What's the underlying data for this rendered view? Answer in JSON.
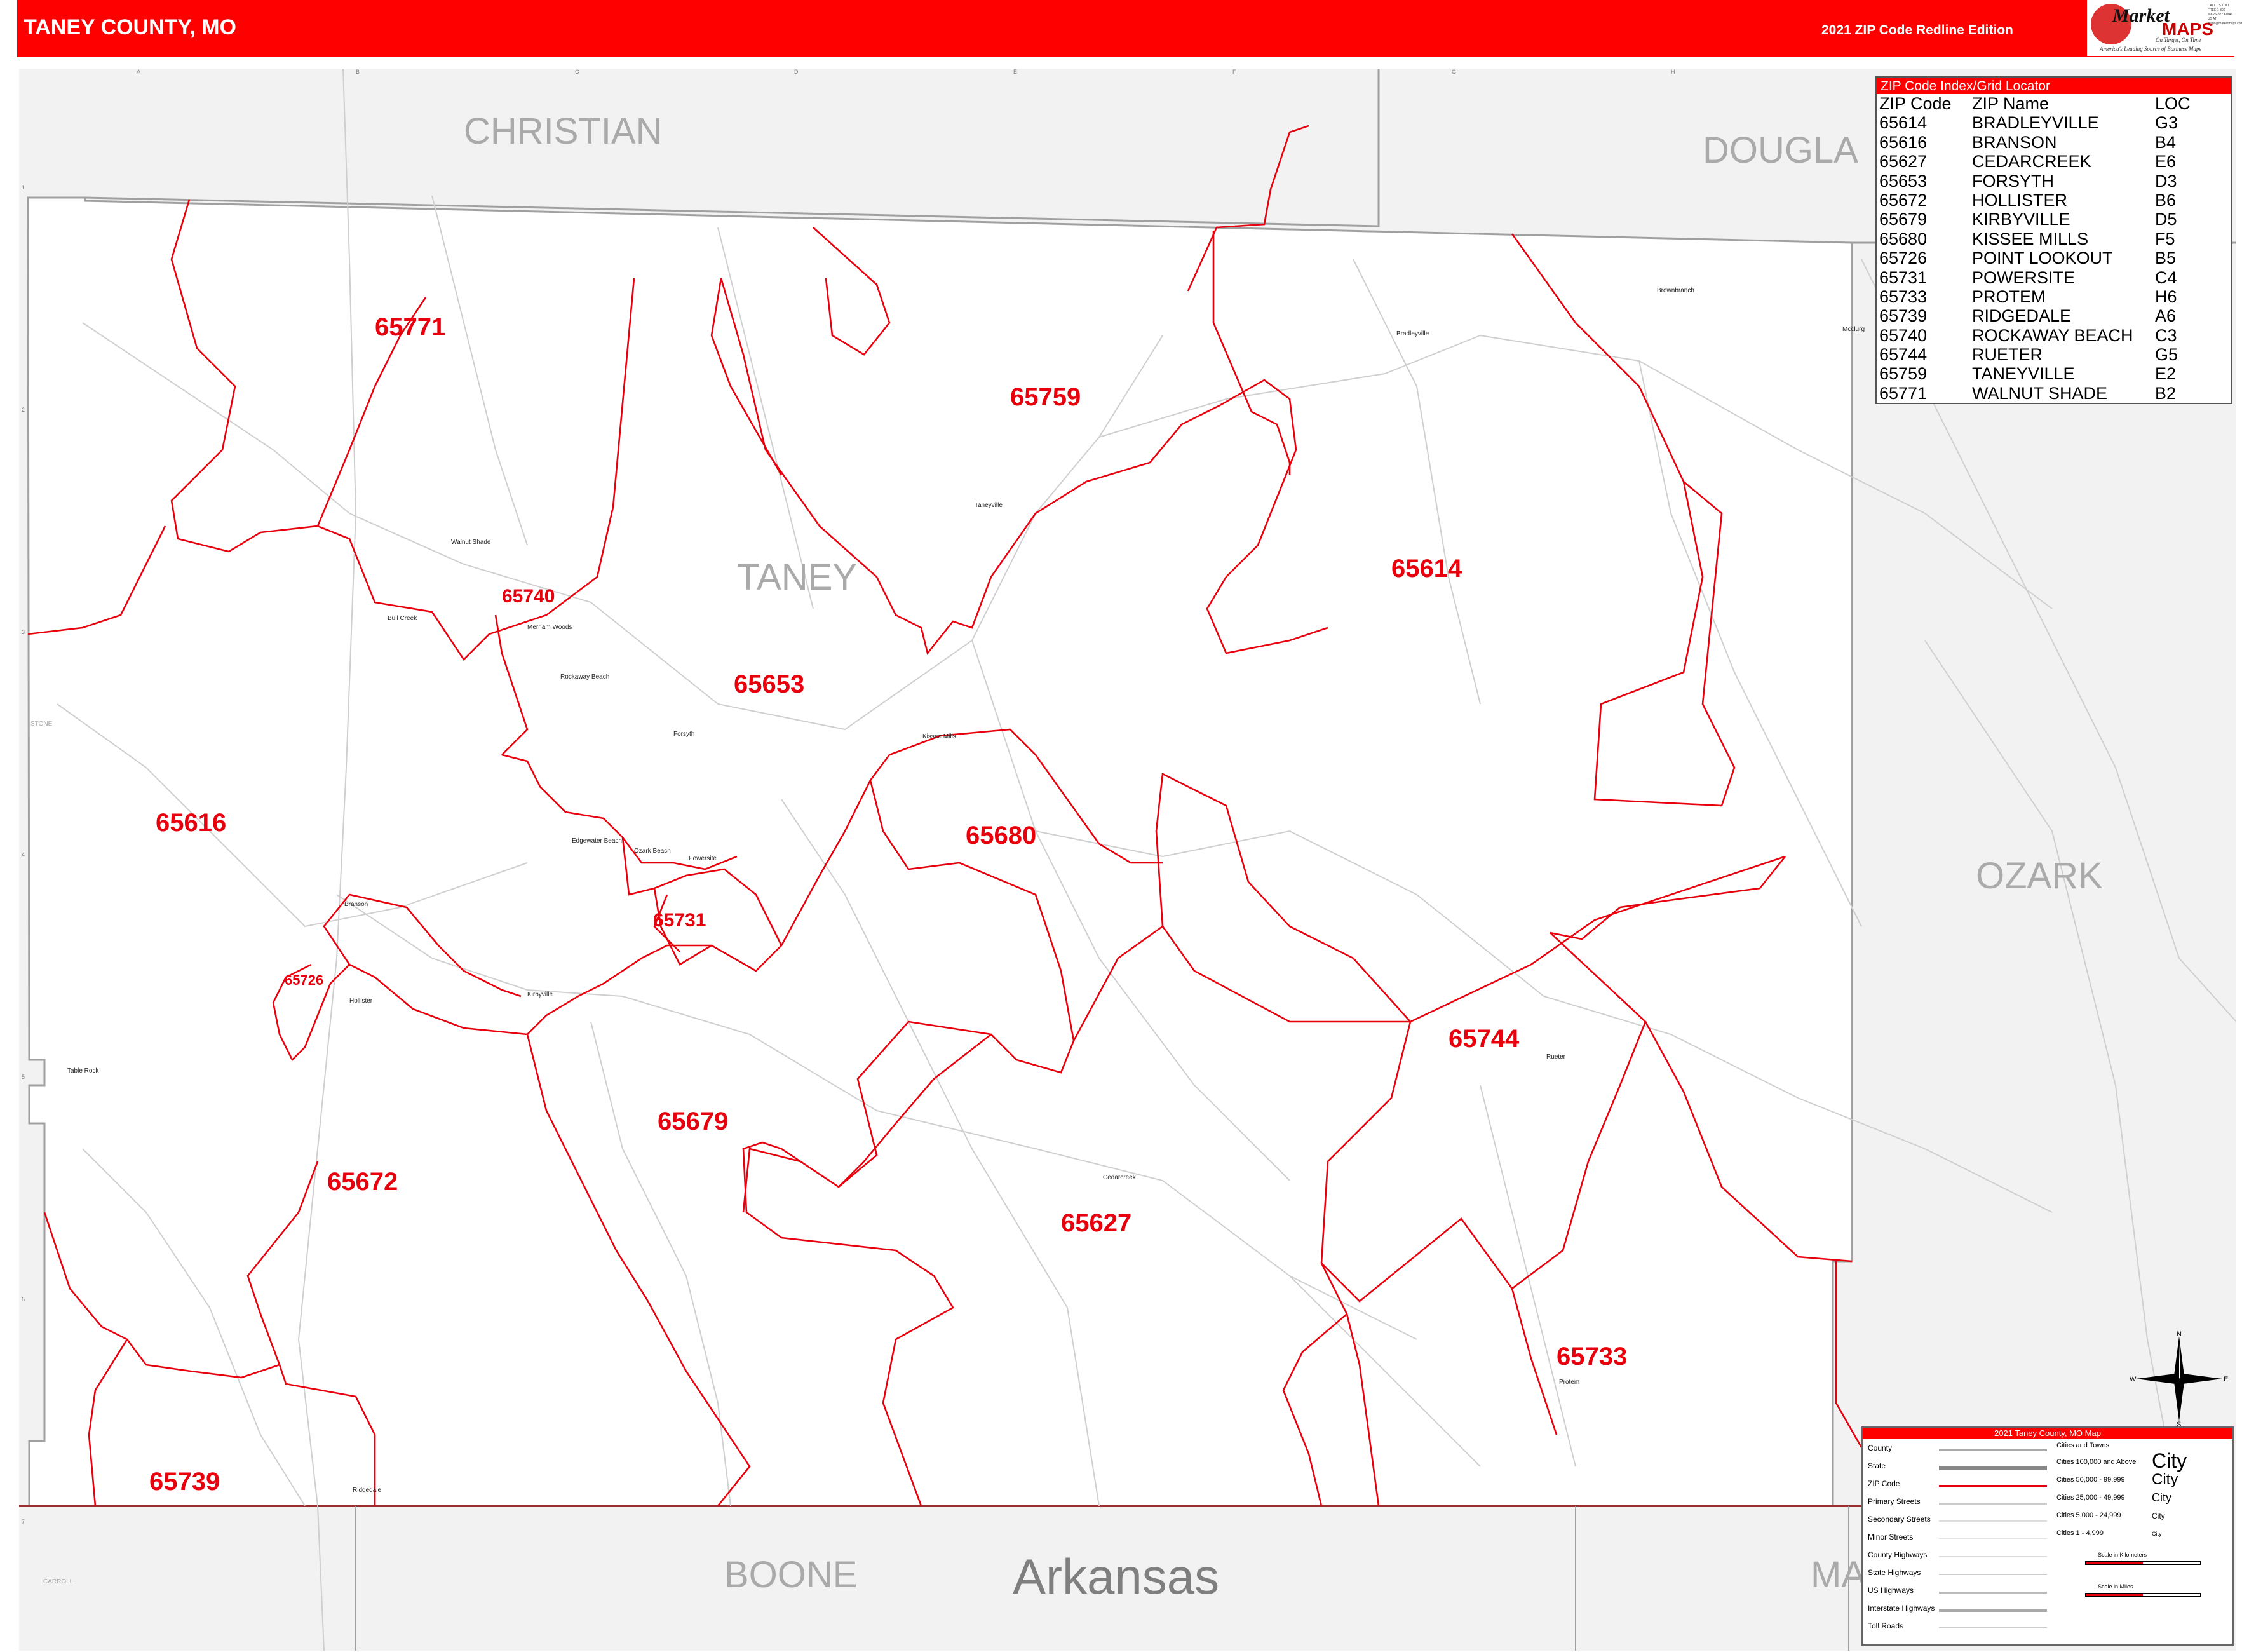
{
  "header": {
    "title": "TANEY COUNTY, MO",
    "edition": "2021 ZIP Code Redline Edition",
    "logo_word": "Market",
    "logo_maps": "MAPS",
    "logo_tagline": "On Target, On Time",
    "logo_subtag": "America's Leading Source of Business Maps",
    "logo_contact": "CALL US TOLL FREE 1-800-MAPS-877 EMAIL US AT maps@marketmaps.com"
  },
  "colors": {
    "header_red": "#ff0000",
    "zip_boundary": "#e8000d",
    "zip_label": "#e8000d",
    "county_line": "#a0a0a0",
    "outside_fill": "#f2f2f2",
    "road_gray": "#cfcfcf",
    "state_line": "#9b2f2f"
  },
  "grid": {
    "columns": [
      "A",
      "B",
      "C",
      "D",
      "E",
      "F",
      "G",
      "H"
    ],
    "rows": [
      "1",
      "2",
      "3",
      "4",
      "5",
      "6",
      "7"
    ]
  },
  "county_labels": {
    "christian": "CHRISTIAN",
    "douglas": "DOUGLA",
    "ozark": "OZARK",
    "boone": "BOONE",
    "arkansas": "Arkansas",
    "marion": "MA",
    "taney": "TANEY",
    "stone": "STONE",
    "carroll": "CARROLL"
  },
  "zip_labels": {
    "z65771": "65771",
    "z65759": "65759",
    "z65614": "65614",
    "z65740": "65740",
    "z65653": "65653",
    "z65616": "65616",
    "z65680": "65680",
    "z65731": "65731",
    "z65726": "65726",
    "z65744": "65744",
    "z65679": "65679",
    "z65672": "65672",
    "z65627": "65627",
    "z65733": "65733",
    "z65739": "65739"
  },
  "town_labels": {
    "bradleyville": "Bradleyville",
    "brownbranch": "Brownbranch",
    "mcclurg": "Mcclurg",
    "taneyville": "Taneyville",
    "walnut_shade": "Walnut Shade",
    "bull_creek": "Bull Creek",
    "merriam_woods": "Merriam Woods",
    "rockaway_beach": "Rockaway Beach",
    "forsyth": "Forsyth",
    "kissee_mills": "Kissee Mills",
    "edgewater_beach": "Edgewater Beach",
    "ozark_beach": "Ozark Beach",
    "powersite": "Powersite",
    "branson": "Branson",
    "hollister": "Hollister",
    "kirbyville": "Kirbyville",
    "table_rock": "Table Rock",
    "rueter": "Rueter",
    "cedarcreek": "Cedarcreek",
    "protem": "Protem",
    "ridgedale": "Ridgedale"
  },
  "zip_index": {
    "title": "ZIP Code Index/Grid Locator",
    "headers": [
      "ZIP Code",
      "ZIP Name",
      "LOC"
    ],
    "rows": [
      [
        "65614",
        "BRADLEYVILLE",
        "G3"
      ],
      [
        "65616",
        "BRANSON",
        "B4"
      ],
      [
        "65627",
        "CEDARCREEK",
        "E6"
      ],
      [
        "65653",
        "FORSYTH",
        "D3"
      ],
      [
        "65672",
        "HOLLISTER",
        "B6"
      ],
      [
        "65679",
        "KIRBYVILLE",
        "D5"
      ],
      [
        "65680",
        "KISSEE MILLS",
        "F5"
      ],
      [
        "65726",
        "POINT LOOKOUT",
        "B5"
      ],
      [
        "65731",
        "POWERSITE",
        "C4"
      ],
      [
        "65733",
        "PROTEM",
        "H6"
      ],
      [
        "65739",
        "RIDGEDALE",
        "A6"
      ],
      [
        "65740",
        "ROCKAWAY BEACH",
        "C3"
      ],
      [
        "65744",
        "RUETER",
        "G5"
      ],
      [
        "65759",
        "TANEYVILLE",
        "E2"
      ],
      [
        "65771",
        "WALNUT SHADE",
        "B2"
      ]
    ]
  },
  "legend": {
    "title": "2021 Taney County, MO Map",
    "left_items": [
      "County",
      "State",
      "ZIP Code",
      "Primary Streets",
      "Secondary Streets",
      "Minor Streets",
      "County Highways",
      "State Highways",
      "US Highways",
      "Interstate Highways",
      "Toll Roads"
    ],
    "right_items": [
      "Cities and Towns",
      "Cities 100,000 and Above",
      "Cities 50,000 - 99,999",
      "Cities 25,000 - 49,999",
      "Cities 5,000 - 24,999",
      "Cities 1 - 4,999"
    ],
    "city_samples": [
      "City",
      "City",
      "City",
      "City",
      "City"
    ],
    "scale_km": "Scale in Kilometers",
    "scale_mi": "Scale in Miles"
  },
  "compass": {
    "n": "N",
    "s": "S",
    "e": "E",
    "w": "W"
  }
}
